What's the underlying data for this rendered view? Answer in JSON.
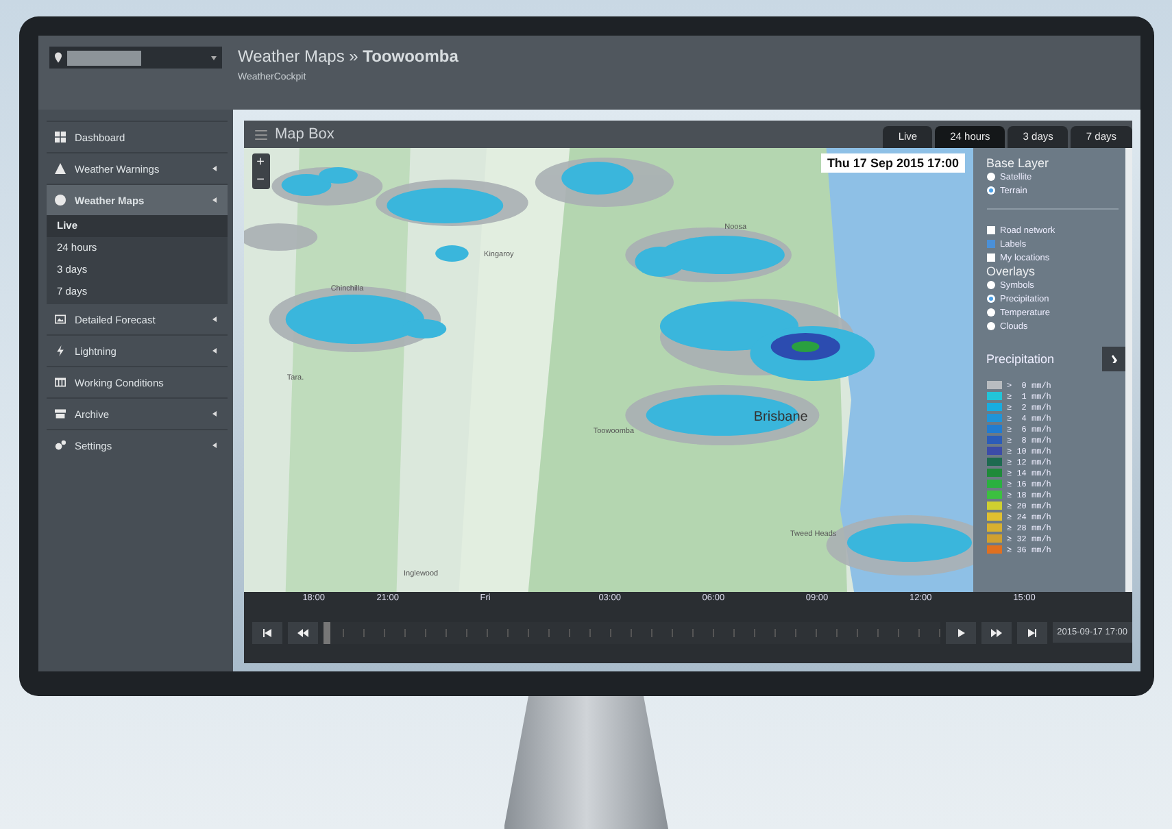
{
  "header": {
    "breadcrumb": "Weather Maps » **Toowoomba**",
    "subtitle": "WeatherCockpit"
  },
  "sidebar": {
    "items": [
      {
        "label": "Dashboard",
        "expandable": false,
        "selected": false
      },
      {
        "label": "Weather Warnings",
        "expandable": true,
        "selected": false
      },
      {
        "label": "Weather Maps",
        "expandable": true,
        "selected": true,
        "children": [
          {
            "label": "Live",
            "selected": true
          },
          {
            "label": "24 hours",
            "selected": false
          },
          {
            "label": "3 days",
            "selected": false
          },
          {
            "label": "7 days",
            "selected": false
          }
        ]
      },
      {
        "label": "Detailed Forecast",
        "expandable": true,
        "selected": false
      },
      {
        "label": "Lightning",
        "expandable": true,
        "selected": false
      },
      {
        "label": "Working Conditions",
        "expandable": false,
        "selected": false
      },
      {
        "label": "Archive",
        "expandable": true,
        "selected": false
      },
      {
        "label": "Settings",
        "expandable": true,
        "selected": false
      }
    ]
  },
  "map_box": {
    "title": "Map Box",
    "tabs": [
      {
        "label": "Live",
        "selected": false
      },
      {
        "label": "24 hours",
        "selected": true
      },
      {
        "label": "3 days",
        "selected": false
      },
      {
        "label": "7 days",
        "selected": false
      }
    ],
    "timestamp": "Thu 17 Sep 2015 17:00",
    "zoom": [
      "+",
      "−"
    ],
    "places": [
      "Brisbane",
      "Toowoomba",
      "Tara.",
      "Chinchilla",
      "Kingaroy",
      "Noosa",
      "Tweed Heads",
      "Inglewood"
    ],
    "base_layer": {
      "title": "Base Layer",
      "options": [
        {
          "label": "Satellite",
          "selected": false
        },
        {
          "label": "Terrain",
          "selected": true
        }
      ]
    },
    "layers": [
      {
        "label": "Road network",
        "checked": false
      },
      {
        "label": "Labels",
        "checked": true
      },
      {
        "label": "My locations",
        "checked": false
      }
    ],
    "overlays": {
      "title": "Overlays",
      "options": [
        {
          "label": "Symbols",
          "selected": false
        },
        {
          "label": "Precipitation",
          "selected": true
        },
        {
          "label": "Temperature",
          "selected": false
        },
        {
          "label": "Clouds",
          "selected": false
        }
      ]
    },
    "legend": {
      "title": "Precipitation",
      "rows": [
        {
          "label": ">  0 mm/h",
          "color": "#b8bcc0"
        },
        {
          "label": "≥  1 mm/h",
          "color": "#22c4d8"
        },
        {
          "label": "≥  2 mm/h",
          "color": "#18ace0"
        },
        {
          "label": "≥  4 mm/h",
          "color": "#2094d8"
        },
        {
          "label": "≥  6 mm/h",
          "color": "#227cd0"
        },
        {
          "label": "≥  8 mm/h",
          "color": "#2c5cb8"
        },
        {
          "label": "≥ 10 mm/h",
          "color": "#3c4ca8"
        },
        {
          "label": "≥ 12 mm/h",
          "color": "#1e6a50"
        },
        {
          "label": "≥ 14 mm/h",
          "color": "#1f8a3a"
        },
        {
          "label": "≥ 16 mm/h",
          "color": "#2ab040"
        },
        {
          "label": "≥ 18 mm/h",
          "color": "#3cc040"
        },
        {
          "label": "≥ 20 mm/h",
          "color": "#d0d030"
        },
        {
          "label": "≥ 24 mm/h",
          "color": "#e0c030"
        },
        {
          "label": "≥ 28 mm/h",
          "color": "#d8b030"
        },
        {
          "label": "≥ 32 mm/h",
          "color": "#d0a030"
        },
        {
          "label": "≥ 36 mm/h",
          "color": "#e07020"
        }
      ]
    },
    "timeline": {
      "labels": [
        "18:00",
        "21:00",
        "Fri",
        "03:00",
        "06:00",
        "09:00",
        "12:00",
        "15:00"
      ],
      "current": "2015-09-17 17:00"
    }
  }
}
